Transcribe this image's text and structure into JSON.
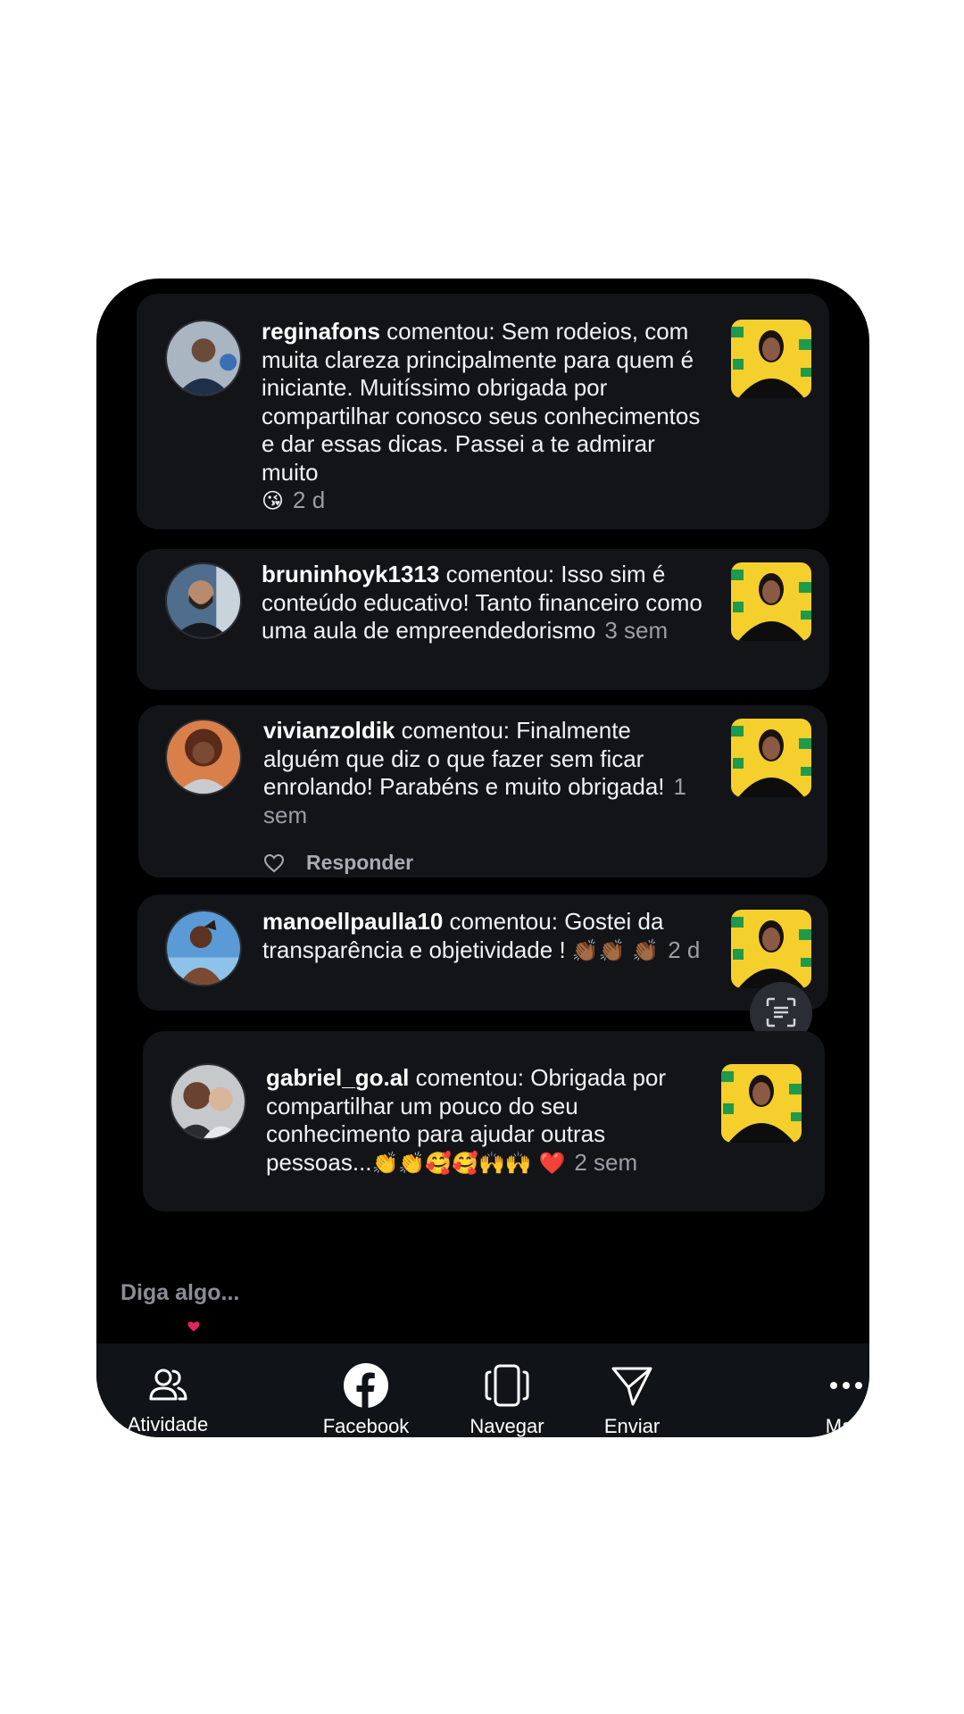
{
  "comments": [
    {
      "username": "reginafons",
      "verb": "comentou:",
      "text": "Sem rodeios, com muita clareza principalmente para quem é iniciante. Muitíssimo obrigada por compartilhar conosco seus conhecimentos e dar essas dicas. Passei a te admirar muito",
      "emoji": "😘",
      "time": "2 d"
    },
    {
      "username": "bruninhoyk1313",
      "verb": "comentou:",
      "text": "Isso sim é conteúdo educativo! Tanto financeiro como uma aula de empreendedorismo",
      "emoji": "",
      "time": "3 sem"
    },
    {
      "username": "vivianzoldik",
      "verb": "comentou:",
      "text": "Finalmente alguém que diz o que fazer sem ficar enrolando! Parabéns e muito obrigada!",
      "emoji": "",
      "time": "1 sem",
      "reply_label": "Responder"
    },
    {
      "username": "manoellpaulla10",
      "verb": "comentou:",
      "text": "Gostei da transparência e objetividade !",
      "emoji": "👏🏾👏🏾 👏🏾",
      "time": "2 d"
    },
    {
      "username": "gabriel_go.al",
      "verb": "comentou:",
      "text": "Obrigada por compartilhar um pouco do seu conhecimento para ajudar  outras pessoas...",
      "emoji": "👏👏🥰🥰🙌🙌 ❤️",
      "time": "2 sem"
    }
  ],
  "input": {
    "placeholder": "Diga algo..."
  },
  "toolbar": {
    "items": [
      {
        "label": "Atividade",
        "icon": "people-icon"
      },
      {
        "label": "Facebook",
        "icon": "facebook-icon"
      },
      {
        "label": "Navegar",
        "icon": "browse-icon"
      },
      {
        "label": "Enviar",
        "icon": "send-icon"
      },
      {
        "label": "Mais",
        "icon": "more-icon"
      }
    ]
  },
  "colors": {
    "background": "#000000",
    "card": "#121418",
    "toolbar": "#101318",
    "muted_text": "#9a9ea6",
    "heart": "#e0245e",
    "thumb_yellow": "#f5cf2c",
    "thumb_green": "#1f9a4b"
  }
}
